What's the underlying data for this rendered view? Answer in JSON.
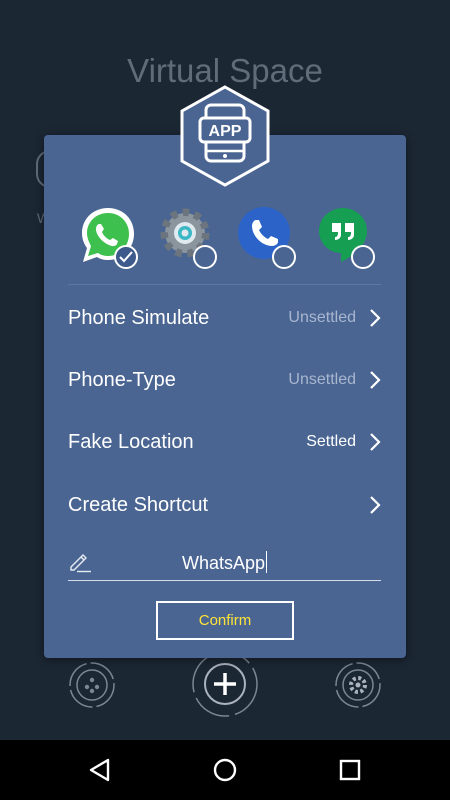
{
  "app": {
    "title": "Virtual Space"
  },
  "badge": {
    "label": "APP"
  },
  "apps": [
    {
      "name": "whatsapp-app",
      "icon": "whatsapp-icon",
      "selected": true
    },
    {
      "name": "settings-app",
      "icon": "settings-gear-icon",
      "selected": false
    },
    {
      "name": "phone-app",
      "icon": "phone-icon",
      "selected": false
    },
    {
      "name": "hangouts-app",
      "icon": "hangouts-icon",
      "selected": false
    }
  ],
  "settings": [
    {
      "label": "Phone Simulate",
      "status": "Unsettled"
    },
    {
      "label": "Phone-Type",
      "status": "Unsettled"
    },
    {
      "label": "Fake Location",
      "status": "Settled"
    },
    {
      "label": "Create Shortcut",
      "status": ""
    }
  ],
  "shortcut_name": {
    "value": "WhatsApp"
  },
  "confirm": {
    "label": "Confirm"
  },
  "colors": {
    "background": "#1c2734",
    "dialog": "#4a6592",
    "confirm_text": "#ffe436",
    "unsettled_text": "#a8b6cf"
  }
}
